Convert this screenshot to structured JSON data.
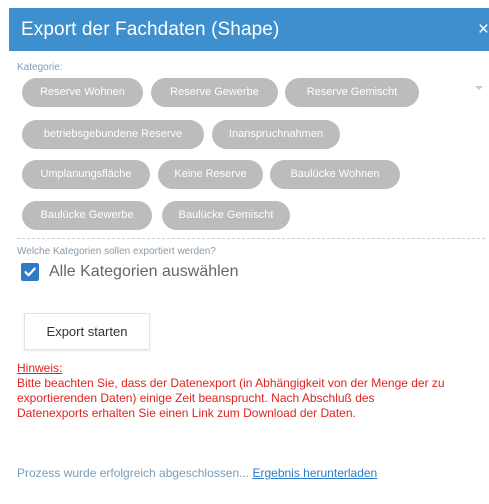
{
  "dialog": {
    "title": "Export der Fachdaten (Shape)",
    "close_symbol": "×"
  },
  "category": {
    "label": "Kategorie:",
    "chips": [
      "Reserve Wohnen",
      "Reserve Gewerbe",
      "Reserve Gemischt",
      "betriebsgebundene Reserve",
      "Inanspruchnahmen",
      "Umplanungsfläche",
      "Keine Reserve",
      "Baulücke Wohnen",
      "Baulücke Gewerbe",
      "Baulücke Gemischt"
    ]
  },
  "export_question": "Welche Kategorien sollen exportiert werden?",
  "select_all": {
    "label": "Alle Kategorien auswählen",
    "checked": true
  },
  "export_button": "Export starten",
  "hint": {
    "title": "Hinweis:",
    "line1": "Bitte beachten Sie, dass der Datenexport (in Abhängigkeit von der Menge der zu",
    "line2": "exportierenden Daten) einige Zeit beansprucht. Nach Abschluß des",
    "line3": "Datenexports erhalten Sie einen Link zum Download der Daten."
  },
  "status": {
    "text": "Prozess wurde erfolgreich abgeschlossen...",
    "link": "Ergebnis herunterladen"
  },
  "colors": {
    "header": "#3d8fce",
    "chip": "#bcbcbc",
    "checkbox": "#2e7bc4",
    "hint": "#e0241e",
    "link": "#2d7bc9"
  },
  "icons": [
    "close-icon",
    "dropdown-arrow-icon",
    "checkmark-icon"
  ]
}
